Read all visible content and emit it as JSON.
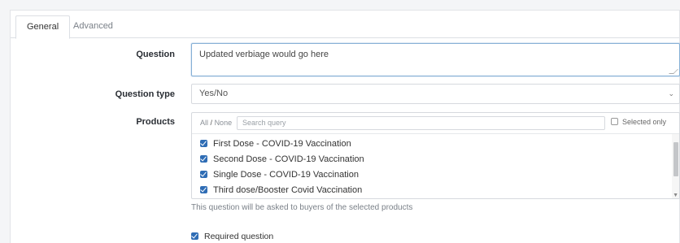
{
  "tabs": [
    {
      "label": "General",
      "active": true
    },
    {
      "label": "Advanced",
      "active": false
    }
  ],
  "form": {
    "question_label": "Question",
    "question_value": "Updated verbiage would go here",
    "question_type_label": "Question type",
    "question_type_value": "Yes/No",
    "products_label": "Products",
    "all_label": "All",
    "all_none_separator": "/",
    "none_label": "None",
    "search_placeholder": "Search query",
    "selected_only_label": "Selected only",
    "products": [
      {
        "label": "First Dose - COVID-19 Vaccination",
        "checked": true
      },
      {
        "label": "Second Dose - COVID-19 Vaccination",
        "checked": true
      },
      {
        "label": "Single Dose - COVID-19 Vaccination",
        "checked": true
      },
      {
        "label": "Third dose/Booster Covid Vaccination",
        "checked": true
      }
    ],
    "products_help": "This question will be asked to buyers of the selected products",
    "required_label": "Required question",
    "required_checked": true
  },
  "colors": {
    "accent": "#2f6db5",
    "focus_border": "#86b0d6"
  }
}
